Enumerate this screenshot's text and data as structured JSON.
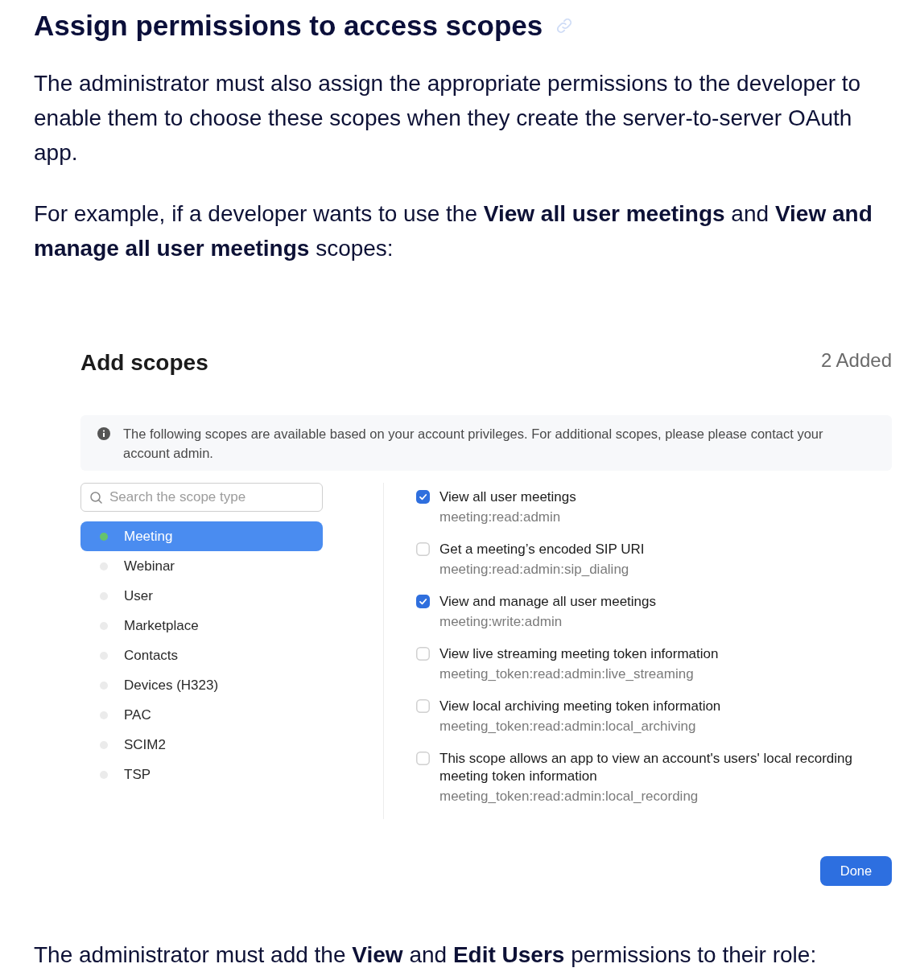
{
  "heading": {
    "title": "Assign permissions to access scopes"
  },
  "paragraphs": [
    "The administrator must also assign the appropriate permissions to the developer to enable them to choose these scopes when they create the server-to-server OAuth app.",
    "For example, if a developer wants to use the **View all user meetings** and **View and manage all user meetings** scopes:"
  ],
  "dialog": {
    "title": "Add scopes",
    "added_count": "2 Added",
    "notice": "The following scopes are available based on your account privileges. For additional scopes, please please contact your account admin.",
    "search": {
      "placeholder": "Search the scope type"
    },
    "categories": [
      {
        "label": "Meeting",
        "selected": true,
        "color": "#66c36c"
      },
      {
        "label": "Webinar",
        "selected": false,
        "color": "#ebebeb"
      },
      {
        "label": "User",
        "selected": false,
        "color": "#ebebeb"
      },
      {
        "label": "Marketplace",
        "selected": false,
        "color": "#ebebeb"
      },
      {
        "label": "Contacts",
        "selected": false,
        "color": "#ebebeb"
      },
      {
        "label": "Devices (H323)",
        "selected": false,
        "color": "#ebebeb"
      },
      {
        "label": "PAC",
        "selected": false,
        "color": "#ebebeb"
      },
      {
        "label": "SCIM2",
        "selected": false,
        "color": "#ebebeb"
      },
      {
        "label": "TSP",
        "selected": false,
        "color": "#ebebeb"
      }
    ],
    "scopes": [
      {
        "title": "View all user meetings",
        "scope": "meeting:read:admin",
        "checked": true
      },
      {
        "title": "Get a meeting’s encoded SIP URI",
        "scope": "meeting:read:admin:sip_dialing",
        "checked": false
      },
      {
        "title": "View and manage all user meetings",
        "scope": "meeting:write:admin",
        "checked": true
      },
      {
        "title": "View live streaming meeting token information",
        "scope": "meeting_token:read:admin:live_streaming",
        "checked": false
      },
      {
        "title": "View local archiving meeting token information",
        "scope": "meeting_token:read:admin:local_archiving",
        "checked": false
      },
      {
        "title": "This scope allows an app to view an account's users' local recording meeting token information",
        "scope": "meeting_token:read:admin:local_recording",
        "checked": false
      }
    ],
    "done_button": "Done"
  },
  "closing_paragraph": "The administrator must add the **View** and **Edit Users** permissions to their role:"
}
